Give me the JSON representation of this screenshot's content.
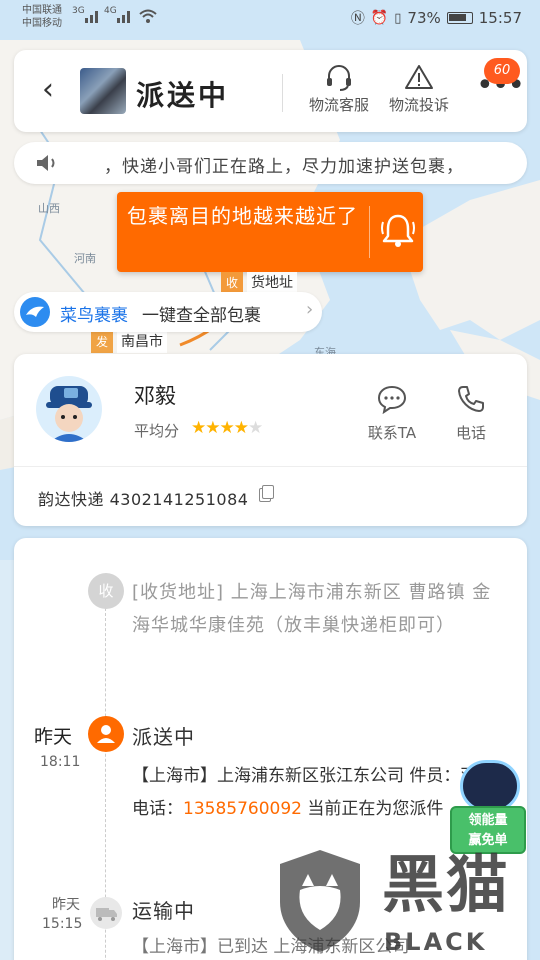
{
  "status_bar": {
    "carrier1": "中国联通",
    "carrier2": "中国移动",
    "net1": "3G",
    "net2": "4G",
    "battery": "73%",
    "time": "15:57"
  },
  "header": {
    "title": "派送中",
    "service_label": "物流客服",
    "complaint_label": "物流投诉",
    "more_badge": "60"
  },
  "notice": {
    "text": "，快递小哥们正在路上，尽力加速护送包裹，"
  },
  "alert": {
    "message": "包裹离目的地越来越近了"
  },
  "map": {
    "labels": [
      "山西",
      "河南",
      "东海"
    ],
    "recv_pin": "收",
    "recv_label": "货地址",
    "send_pin": "发",
    "send_label": "南昌市"
  },
  "cainiao": {
    "brand": "菜鸟裹裹",
    "text": "一键查全部包裹"
  },
  "courier": {
    "name": "邓毅",
    "score_label": "平均分",
    "rating": 4,
    "contact_label": "联系TA",
    "phone_label": "电话",
    "tracking": "韵达快递 4302141251084"
  },
  "timeline": {
    "recv_node": "收",
    "address": "[收货地址] 上海上海市浦东新区 曹路镇  金海华城华康佳苑（放丰巢快递柜即可）",
    "events": [
      {
        "date": "昨天",
        "time": "18:11",
        "title": "派送中",
        "detail_pre": "【上海市】上海浦东新区张江东公司 件员：邓毅 电话：",
        "phone": "13585760092",
        "detail_post": " 当前正在为您派件"
      },
      {
        "date": "昨天",
        "time": "15:15",
        "title": "运输中",
        "detail": "【上海市】已到达 上海浦东新区公司"
      }
    ]
  },
  "promo": {
    "line1": "领能量",
    "line2": "赢免单"
  },
  "watermark": {
    "cn": "黑猫",
    "en": "BLACK CAT"
  },
  "colors": {
    "accent": "#ff6a00",
    "link": "#1a73e8",
    "map": "#cfe6f7"
  }
}
